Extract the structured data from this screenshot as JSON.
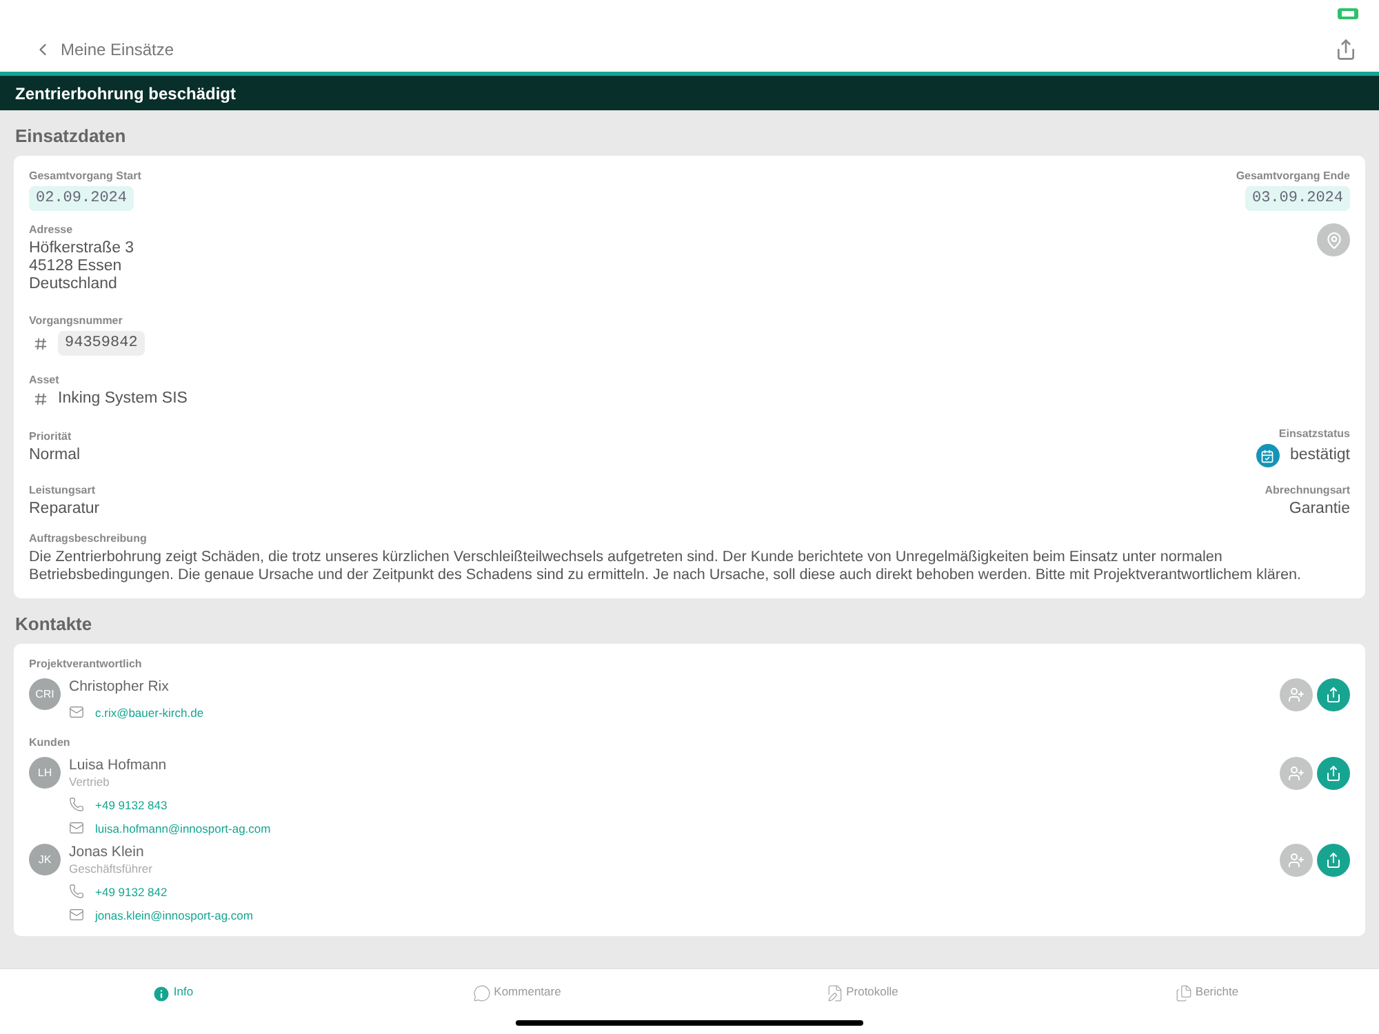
{
  "nav": {
    "back_label": "Meine Einsätze"
  },
  "title": "Zentrierbohrung beschädigt",
  "einsatzdaten": {
    "heading": "Einsatzdaten",
    "start": {
      "label": "Gesamtvorgang Start",
      "value": "02.09.2024"
    },
    "end": {
      "label": "Gesamtvorgang Ende",
      "value": "03.09.2024"
    },
    "address": {
      "label": "Adresse",
      "lines": [
        "Höfkerstraße 3",
        "45128 Essen",
        "Deutschland"
      ]
    },
    "vorgangsnummer": {
      "label": "Vorgangsnummer",
      "value": "94359842"
    },
    "asset": {
      "label": "Asset",
      "value": "Inking System SIS"
    },
    "prioritaet": {
      "label": "Priorität",
      "value": "Normal"
    },
    "einsatzstatus": {
      "label": "Einsatzstatus",
      "value": "bestätigt"
    },
    "leistungsart": {
      "label": "Leistungsart",
      "value": "Reparatur"
    },
    "abrechnungsart": {
      "label": "Abrechnungsart",
      "value": "Garantie"
    },
    "beschreibung": {
      "label": "Auftragsbeschreibung",
      "value": "Die Zentrierbohrung zeigt Schäden, die trotz unseres kürzlichen Verschleißteilwechsels aufgetreten sind. Der Kunde berichtete von Unregelmäßigkeiten beim Einsatz unter normalen Betriebsbedingungen. Die genaue Ursache und der Zeitpunkt des Schadens sind zu ermitteln. Je nach Ursache, soll diese auch direkt behoben werden. Bitte mit Projektverantwortlichem klären."
    }
  },
  "kontakte": {
    "heading": "Kontakte",
    "groups": [
      {
        "label": "Projektverantwortlich",
        "contacts": [
          {
            "initials": "CRI",
            "name": "Christopher Rix",
            "email": "c.rix@bauer-kirch.de"
          }
        ]
      },
      {
        "label": "Kunden",
        "contacts": [
          {
            "initials": "LH",
            "name": "Luisa Hofmann",
            "role": "Vertrieb",
            "phone": "+49 9132 843",
            "email": "luisa.hofmann@innosport-ag.com"
          },
          {
            "initials": "JK",
            "name": "Jonas Klein",
            "role": "Geschäftsführer",
            "phone": "+49 9132 842",
            "email": "jonas.klein@innosport-ag.com"
          }
        ]
      }
    ]
  },
  "tabs": [
    {
      "kind": "info",
      "label": "Info",
      "selected": true
    },
    {
      "kind": "comments",
      "label": "Kommentare",
      "selected": false
    },
    {
      "kind": "protocols",
      "label": "Protokolle",
      "selected": false
    },
    {
      "kind": "reports",
      "label": "Berichte",
      "selected": false
    }
  ]
}
